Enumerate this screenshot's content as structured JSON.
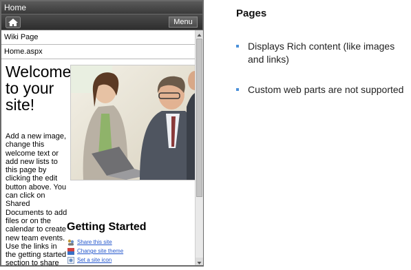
{
  "phone": {
    "title": "Home",
    "menu_label": "Menu",
    "breadcrumb": "Wiki Page",
    "page_name": "Home.aspx",
    "welcome_heading": "Welcome to your site!",
    "welcome_body": "Add a new image, change this welcome text or add new lists to this page by clicking the edit button above. You can click on Shared Documents to add files or on the calendar to create new team events. Use the links in the getting started section to share",
    "getting_started_title": "Getting Started",
    "links": [
      {
        "label": "Share this site",
        "icon": "share-site-icon"
      },
      {
        "label": "Change site theme",
        "icon": "theme-icon"
      },
      {
        "label": "Set a site icon",
        "icon": "site-icon"
      }
    ]
  },
  "slide": {
    "title": "Pages",
    "bullets": [
      "Displays Rich content (like images and links)",
      "Custom web parts are not supported"
    ]
  },
  "colors": {
    "link": "#2255cc",
    "bullet": "#4a90d9",
    "bar_dark": "#2e2e2e"
  }
}
